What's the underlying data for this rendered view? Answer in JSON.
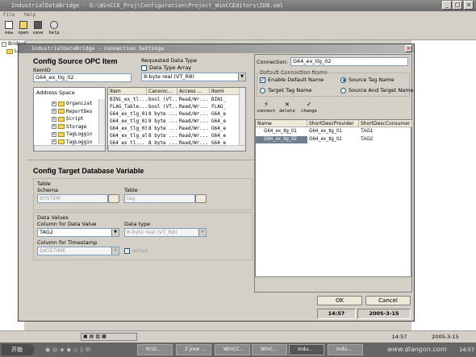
{
  "app": {
    "title": "IndustrialDataBridge - G:\\WinCC6_Proj\\Configuration\\Project_WinCCEditors\\IDB.xml",
    "window_buttons": [
      "_",
      "□",
      "×"
    ]
  },
  "menu": [
    "File",
    "Help"
  ],
  "toolbar": [
    {
      "label": "new",
      "icon": "new-file-icon"
    },
    {
      "label": "open",
      "icon": "open-folder-icon"
    },
    {
      "label": "save",
      "icon": "save-icon"
    },
    {
      "label": "help",
      "icon": "help-icon"
    }
  ],
  "tree": {
    "root": "Bridges",
    "child": "Lo"
  },
  "dialog": {
    "title": "IndustrialDataBridge - Connection Settings",
    "source": {
      "heading": "Config Source OPC Item",
      "itemid_label": "ItemID",
      "itemid_value": "G64_ex_tlg_02",
      "requested_type_label": "Requested Data Type",
      "type_array_label": "Data Type Array",
      "requested_type_value": "8-byte real (VT_R8)",
      "address_space_label": "Address Space",
      "folders": [
        "Organizat",
        "ReportDes",
        "Script",
        "Storage",
        "TagLoggin",
        "TagLoggin"
      ],
      "columns": [
        "Item",
        "Canonic...",
        "Access ...",
        "ItemI"
      ],
      "items": [
        [
          "BINi_ex_tl...",
          "bool (VT...",
          "Read/Wr...",
          "BINi_"
        ],
        [
          "FLAG_Table...",
          "bool (VT...",
          "Read/Wr...",
          "FLAG_"
        ],
        [
          "G64_ex_tlg_01",
          "8 byte ...",
          "Read/Wr...",
          "G64_e"
        ],
        [
          "G64_ex_tlg_02",
          "8 byte ...",
          "Read/Wr...",
          "G64_e"
        ],
        [
          "G64_ex_tlg_03",
          "8 byte ...",
          "Read/Wr...",
          "G64_e"
        ],
        [
          "G64_ex_tlg_al",
          "8 byte ...",
          "Read/Wr...",
          "G64_e"
        ],
        [
          "G64_ex_tl...",
          "8 byte ...",
          "Read/Wr...",
          "G64_e"
        ]
      ]
    },
    "target": {
      "heading": "Config Target Database Variable",
      "table_group": "Table",
      "schema_label": "Schema",
      "schema_value": "SYSTEM",
      "table_label": "Table",
      "table_value": "tag",
      "values_group": "Data Values",
      "column_label": "Column for Data Value",
      "column_value": "TAG2",
      "datatype_label": "Data type",
      "datatype_value": "8-byte real (VT_R8)",
      "timestamp_label": "Column for Timestamp",
      "timestamp_value": "DATETIME",
      "active_label": "active"
    },
    "connection": {
      "label": "Connection:",
      "value": "G64_ex_tlg_02",
      "naming_group": "Default Connection Name",
      "enable_default": "Enable Default Name",
      "source_tag": "Source Tag Name",
      "target_tag": "Target Tag Name",
      "source_and_target": "Source And Target Name",
      "buttons": [
        "connect",
        "delete",
        "change"
      ],
      "columns": [
        "Name",
        "ShortDescProvider",
        "ShortDescConsumer"
      ],
      "rows": [
        [
          "G64_ex_tlg_01",
          "G64_ex_tlg_01",
          "TAG1"
        ],
        [
          "G64_ex_tlg_02",
          "G64_ex_tlg_02",
          "TAG2"
        ]
      ]
    },
    "ok": "OK",
    "cancel": "Cancel",
    "time": "14:57",
    "date": "2005-3-15"
  },
  "outer_status": {
    "time": "14:57",
    "date": "2005-3-15"
  },
  "taskbar": {
    "start": "开始",
    "tasks": [
      "H:\\G...",
      "2 jrxw ...",
      "WinCC...",
      "WinC...",
      "Indu...",
      "Indu..."
    ],
    "watermark": "www.diangon.com",
    "clock": "14:57"
  },
  "colors": {
    "selection": "#6f7f8f",
    "title_gradient": "#7e7e7e",
    "taskbar": "#666666"
  }
}
